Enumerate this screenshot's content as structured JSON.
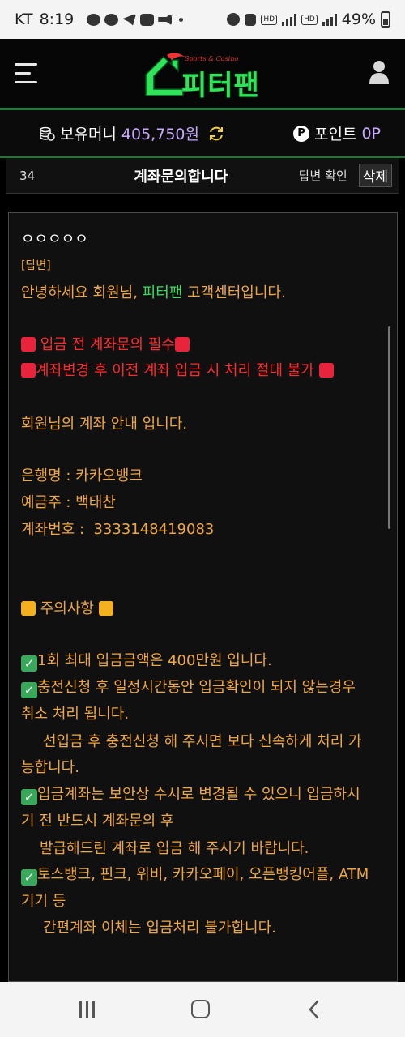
{
  "status_bar": {
    "carrier": "KT",
    "time": "8:19",
    "battery": "49%"
  },
  "header": {
    "logo_text": "피터팬",
    "logo_sub": "Sports & Casino"
  },
  "money_bar": {
    "money_label": "보유머니",
    "money_value": "405,750원",
    "points_label": "포인트",
    "points_value": "0P",
    "points_badge": "P"
  },
  "post": {
    "number": "34",
    "title": "계좌문의합니다",
    "status": "답변 확인",
    "delete_label": "삭제"
  },
  "content": {
    "question": "ㅇㅇㅇㅇㅇ",
    "answer_tag": "[답변]",
    "greeting_pre": "안녕하세요 회원님, ",
    "greeting_brand": "피터팬",
    "greeting_post": " 고객센터입니다.",
    "warn1": "입금 전 계좌문의 필수",
    "warn2": "계좌변경 후 이전 계좌 입금 시 처리 절대 불가",
    "info": "회원님의 계좌 안내 입니다.",
    "bank": "은행명 : 카카오뱅크",
    "holder": "예금주 : 백태찬",
    "account": "계좌번호 :  3333148419083",
    "notice_title": "주의사항",
    "n1": "1회 최대 입금금액은 400만원 입니다.",
    "n2a": "충전신청 후 일정시간동안 입금확인이 되지 않는경우",
    "n2b": "취소 처리 됩니다.",
    "n2c": "선입금 후 충전신청 해 주시면 보다 신속하게 처리 가",
    "n2d": "능합니다.",
    "n3a": "입금계좌는 보안상 수시로 변경될 수 있으니 입금하시",
    "n3b": "기 전 반드시 계좌문의 후",
    "n3c": "발급해드린 계좌로 입금 해 주시기 바랍니다.",
    "n4a": "토스뱅크, 핀크, 위비, 카카오페이, 오픈뱅킹어플, ATM",
    "n4b": "기기 등",
    "n4c": "간편계좌 이체는 입금처리 불가합니다."
  },
  "colors": {
    "accent_green": "#34e05f",
    "answer_orange": "#f0a742",
    "warning_red": "#ff2b2b",
    "value_purple": "#c9a9ff"
  }
}
